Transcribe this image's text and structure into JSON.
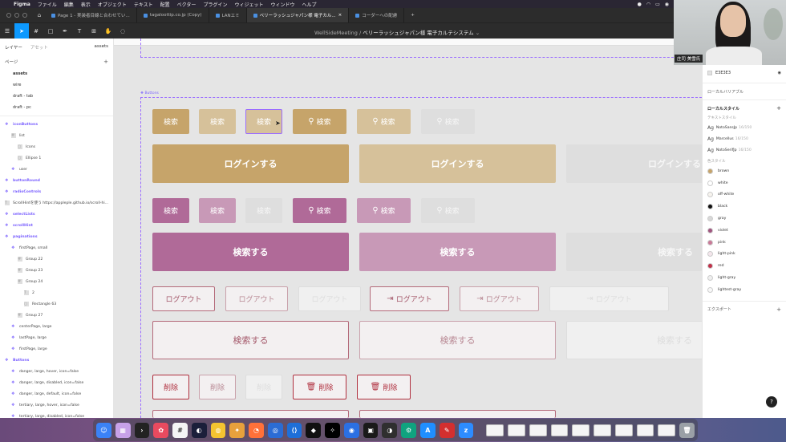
{
  "menubar": {
    "apple": "",
    "app": "Figma",
    "items": [
      "ファイル",
      "編集",
      "表示",
      "オブジェクト",
      "テキスト",
      "配置",
      "ベクター",
      "プラグイン",
      "ウィジェット",
      "ウィンドウ",
      "ヘルプ"
    ]
  },
  "tabs": [
    {
      "label": "Page 1 - 実装者目線と合わせてい..."
    },
    {
      "label": "tagaloottip.co.jp (Copy)"
    },
    {
      "label": "LANエミ"
    },
    {
      "label": "ベリーラッシュジャパン様 電子カル..."
    },
    {
      "label": "コーダーへの配慮"
    }
  ],
  "tab_plus": "+",
  "breadcrumb": {
    "team": "WellSideMeeting",
    "sep": "/",
    "file": "ベリーラッシュジャパン様 電子カルテシステム",
    "chev": "⌄"
  },
  "left": {
    "tab_layers": "レイヤー",
    "tab_assets": "アセット",
    "assets_right": "assets",
    "pages_label": "ページ",
    "plus": "+",
    "pages": [
      "assets",
      "wire",
      "draft - tab",
      "draft - pc"
    ],
    "layers": [
      {
        "label": "iconButtons",
        "depth": 0,
        "kind": "comp"
      },
      {
        "label": "list",
        "depth": 1,
        "kind": "frame"
      },
      {
        "label": "Icons",
        "depth": 2,
        "kind": "shape"
      },
      {
        "label": "Ellipse 1",
        "depth": 2,
        "kind": "shape"
      },
      {
        "label": "user",
        "depth": 1,
        "kind": "comp"
      },
      {
        "label": "buttonRound",
        "depth": 0,
        "kind": "comp"
      },
      {
        "label": "radioControls",
        "depth": 0,
        "kind": "comp"
      },
      {
        "label": "ScrollHintを使う https://appleple.github.io/scroll-hi...",
        "depth": 0,
        "kind": "text"
      },
      {
        "label": "selectLists",
        "depth": 0,
        "kind": "comp"
      },
      {
        "label": "scrollHint",
        "depth": 0,
        "kind": "comp"
      },
      {
        "label": "paginations",
        "depth": 0,
        "kind": "comp"
      },
      {
        "label": "firstPage, small",
        "depth": 1,
        "kind": "comp"
      },
      {
        "label": "Group 22",
        "depth": 2,
        "kind": "frame"
      },
      {
        "label": "Group 23",
        "depth": 2,
        "kind": "frame"
      },
      {
        "label": "Group 24",
        "depth": 2,
        "kind": "frame"
      },
      {
        "label": "2",
        "depth": 3,
        "kind": "text"
      },
      {
        "label": "Rectangle 63",
        "depth": 3,
        "kind": "shape"
      },
      {
        "label": "Group 27",
        "depth": 2,
        "kind": "frame"
      },
      {
        "label": "centerPage, large",
        "depth": 1,
        "kind": "comp"
      },
      {
        "label": "lastPage, large",
        "depth": 1,
        "kind": "comp"
      },
      {
        "label": "firstPage, large",
        "depth": 1,
        "kind": "comp"
      },
      {
        "label": "Buttons",
        "depth": 0,
        "kind": "comp"
      },
      {
        "label": "danger, large, hover, icon=false",
        "depth": 1,
        "kind": "comp"
      },
      {
        "label": "danger, large, disabled, icon=false",
        "depth": 1,
        "kind": "comp"
      },
      {
        "label": "danger, large, default, icon=false",
        "depth": 1,
        "kind": "comp"
      },
      {
        "label": "tertiary, large, hover, icon=false",
        "depth": 1,
        "kind": "comp"
      },
      {
        "label": "tertiary, large, disabled, icon=false",
        "depth": 1,
        "kind": "comp"
      }
    ]
  },
  "canvas": {
    "frame_label": "Buttons",
    "search": "検索",
    "search_do": "検索する",
    "login": "ログインする",
    "logout": "ログアウト",
    "delete": "削除"
  },
  "right": {
    "fill_value": "E3E3E3",
    "local_variables": "ローカルバリアブル",
    "local_styles": "ローカルスタイル",
    "text_styles_label": "テキストスタイル",
    "text_styles": [
      {
        "name": "NotoSansJp",
        "meta": "16/150"
      },
      {
        "name": "Marcellus",
        "meta": "16/150"
      },
      {
        "name": "NotoSerifJp",
        "meta": "16/150"
      }
    ],
    "color_styles_label": "色スタイル",
    "colors": [
      {
        "name": "brown",
        "hex": "#c6a46a"
      },
      {
        "name": "white",
        "hex": "#ffffff"
      },
      {
        "name": "off-white",
        "hex": "#f7f4ee"
      },
      {
        "name": "black",
        "hex": "#111111"
      },
      {
        "name": "gray",
        "hex": "#d8d8d8"
      },
      {
        "name": "violet",
        "hex": "#a0557f"
      },
      {
        "name": "pink",
        "hex": "#c97a98"
      },
      {
        "name": "light-pink",
        "hex": "#f4e6ec"
      },
      {
        "name": "red",
        "hex": "#c0314a"
      },
      {
        "name": "light-gray",
        "hex": "#efefef"
      },
      {
        "name": "lightest-gray",
        "hex": "#f8f8f8"
      }
    ],
    "export": "エクスポート"
  },
  "cam": {
    "name": "庄司 美雪氏"
  },
  "help": "?"
}
